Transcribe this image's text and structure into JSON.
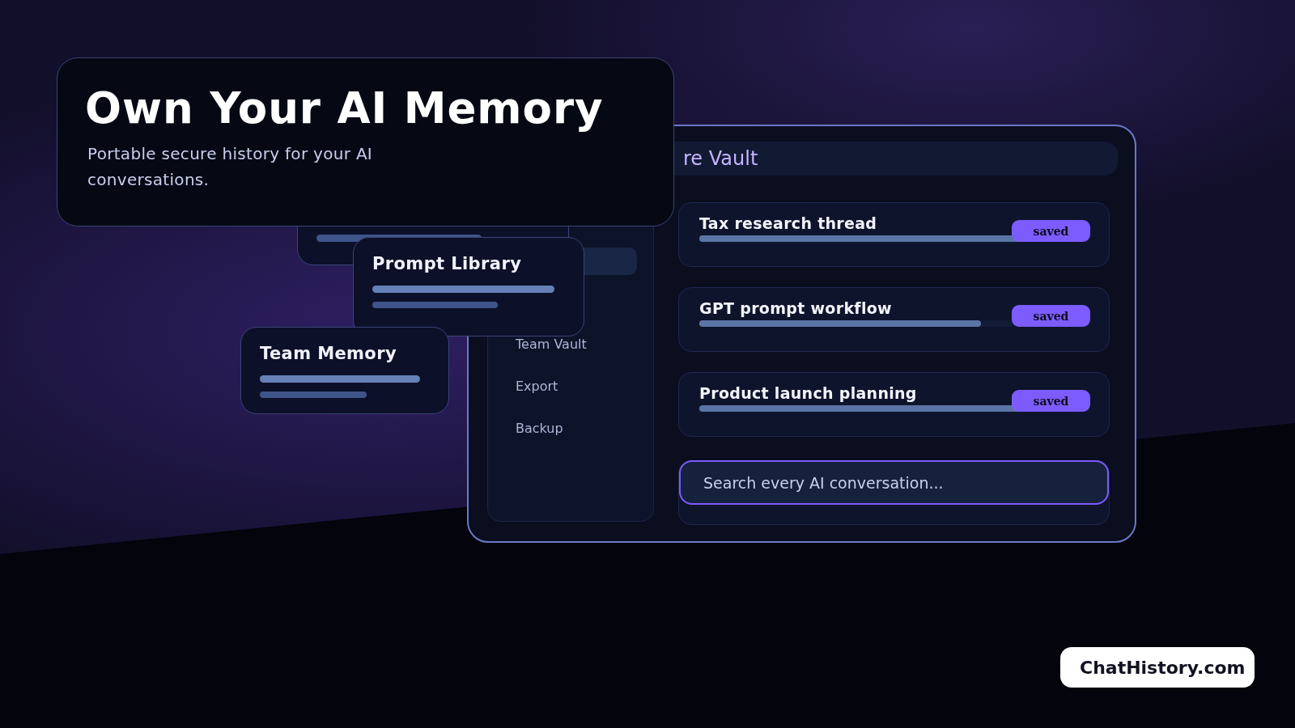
{
  "hero": {
    "title": "Own Your AI Memory",
    "subtitle": "Portable secure history for your AI conversations."
  },
  "vault": {
    "header": "re Vault",
    "sidebar": {
      "items": [
        {
          "label": "Team Vault"
        },
        {
          "label": "Export"
        },
        {
          "label": "Backup"
        }
      ]
    },
    "conversations": [
      {
        "title": "Tax research thread",
        "badge": "saved",
        "level": 0.93
      },
      {
        "title": "GPT prompt workflow",
        "badge": "saved",
        "level": 0.72
      },
      {
        "title": "Product launch planning",
        "badge": "saved",
        "level": 0.91
      }
    ],
    "search": {
      "placeholder": "Search every AI conversation..."
    }
  },
  "floating_cards": [
    {
      "title": "Prompt Library"
    },
    {
      "title": "Team Memory"
    }
  ],
  "logo": {
    "text": "ChatHistory.com"
  }
}
